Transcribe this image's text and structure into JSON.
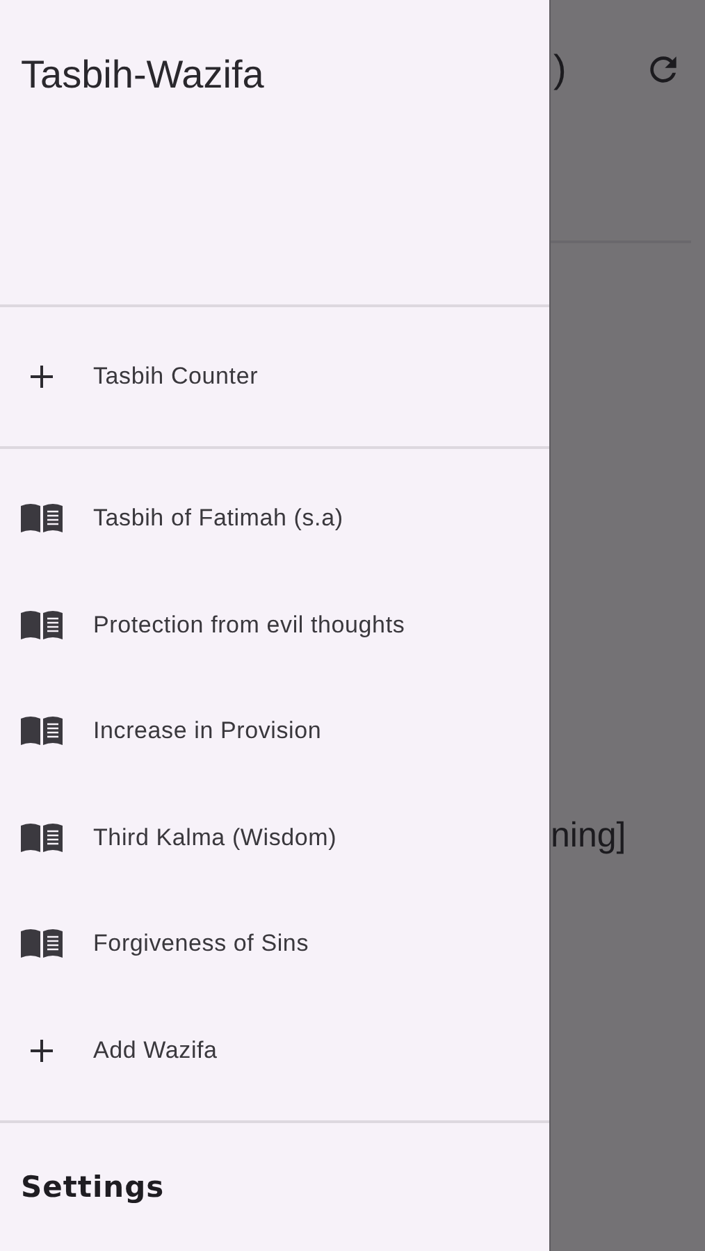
{
  "drawer": {
    "title": "Tasbih-Wazifa",
    "sections": [
      {
        "items": [
          {
            "kind": "add",
            "label": "Tasbih Counter"
          }
        ]
      },
      {
        "items": [
          {
            "kind": "book",
            "label": "Tasbih of Fatimah (s.a)"
          },
          {
            "kind": "book",
            "label": "Protection from evil thoughts"
          },
          {
            "kind": "book",
            "label": "Increase in Provision"
          },
          {
            "kind": "book",
            "label": "Third Kalma (Wisdom)"
          },
          {
            "kind": "book",
            "label": "Forgiveness of Sins"
          },
          {
            "kind": "add",
            "label": "Add Wazifa"
          }
        ]
      }
    ],
    "footer": "Settings"
  },
  "background": {
    "app_bar_text": ")",
    "body_text": "ning]"
  }
}
